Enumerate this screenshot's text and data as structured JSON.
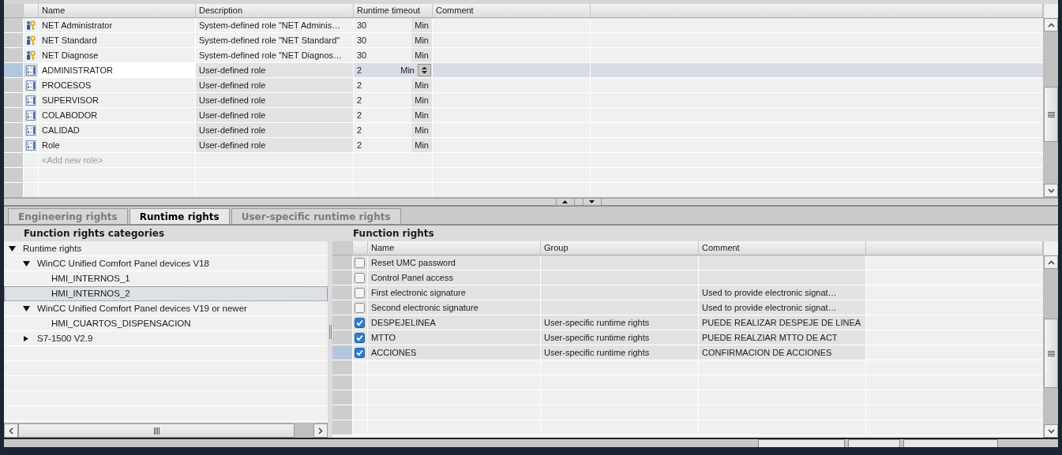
{
  "roles_table": {
    "columns": [
      "Name",
      "Description",
      "Runtime timeout",
      "Comment"
    ],
    "rows": [
      {
        "kind": "system",
        "name": "NET Administrator",
        "description": "System-defined role \"NET Adminis…",
        "timeout": "30",
        "unit": "Min",
        "selected": false
      },
      {
        "kind": "system",
        "name": "NET Standard",
        "description": "System-defined role \"NET Standard\"",
        "timeout": "30",
        "unit": "Min",
        "selected": false
      },
      {
        "kind": "system",
        "name": "NET Diagnose",
        "description": "System-defined role \"NET Diagnos…",
        "timeout": "30",
        "unit": "Min",
        "selected": false
      },
      {
        "kind": "user",
        "name": "ADMINISTRATOR",
        "description": "User-defined role",
        "timeout": "2",
        "unit": "Min",
        "selected": true
      },
      {
        "kind": "user",
        "name": "PROCESOS",
        "description": "User-defined role",
        "timeout": "2",
        "unit": "Min",
        "selected": false
      },
      {
        "kind": "user",
        "name": "SUPERVISOR",
        "description": "User-defined role",
        "timeout": "2",
        "unit": "Min",
        "selected": false
      },
      {
        "kind": "user",
        "name": "COLABODOR",
        "description": "User-defined role",
        "timeout": "2",
        "unit": "Min",
        "selected": false
      },
      {
        "kind": "user",
        "name": "CALIDAD",
        "description": "User-defined role",
        "timeout": "2",
        "unit": "Min",
        "selected": false
      },
      {
        "kind": "user",
        "name": "Role",
        "description": "User-defined role",
        "timeout": "2",
        "unit": "Min",
        "selected": false
      }
    ],
    "add_row": {
      "placeholder": "<Add new role>"
    }
  },
  "tabs": [
    {
      "label": "Engineering rights",
      "selected": false
    },
    {
      "label": "Runtime rights",
      "selected": true
    },
    {
      "label": "User-specific runtime rights",
      "selected": false
    }
  ],
  "categories": {
    "title": "Function rights categories",
    "items": [
      {
        "label": "Runtime rights",
        "expanded": true,
        "selected": false,
        "children": [
          {
            "label": "WinCC Unified Comfort Panel devices V18",
            "expanded": true,
            "selected": false,
            "children": [
              {
                "label": "HMI_INTERNOS_1",
                "selected": false
              },
              {
                "label": "HMI_INTERNOS_2",
                "selected": true
              }
            ]
          },
          {
            "label": "WinCC Unified Comfort Panel devices V19 or newer",
            "expanded": true,
            "selected": false,
            "children": [
              {
                "label": "HMI_CUARTOS_DISPENSACION",
                "selected": false
              }
            ]
          },
          {
            "label": "S7-1500 V2.9",
            "expanded": false,
            "selected": false
          }
        ]
      }
    ]
  },
  "function_rights": {
    "title": "Function rights",
    "columns": [
      "Name",
      "Group",
      "Comment"
    ],
    "rows": [
      {
        "name": "Reset UMC password",
        "group": "",
        "comment": "",
        "checked": false,
        "selected": false
      },
      {
        "name": "Control Panel access",
        "group": "",
        "comment": "",
        "checked": false,
        "selected": false
      },
      {
        "name": "First electronic signature",
        "group": "",
        "comment": "Used to provide electronic signat…",
        "checked": false,
        "selected": false
      },
      {
        "name": "Second electronic signature",
        "group": "",
        "comment": "Used to provide electronic signat…",
        "checked": false,
        "selected": false
      },
      {
        "name": "DESPEJELINEA",
        "group": "User-specific runtime rights",
        "comment": "PUEDE REALIZAR DESPEJE DE LINEA",
        "checked": true,
        "selected": false
      },
      {
        "name": "MTTO",
        "group": "User-specific runtime rights",
        "comment": "PUEDE REALZIAR MTTO DE ACT",
        "checked": true,
        "selected": false
      },
      {
        "name": "ACCIONES",
        "group": "User-specific runtime rights",
        "comment": "CONFIRMACION DE ACCIONES",
        "checked": true,
        "selected": true
      }
    ]
  }
}
